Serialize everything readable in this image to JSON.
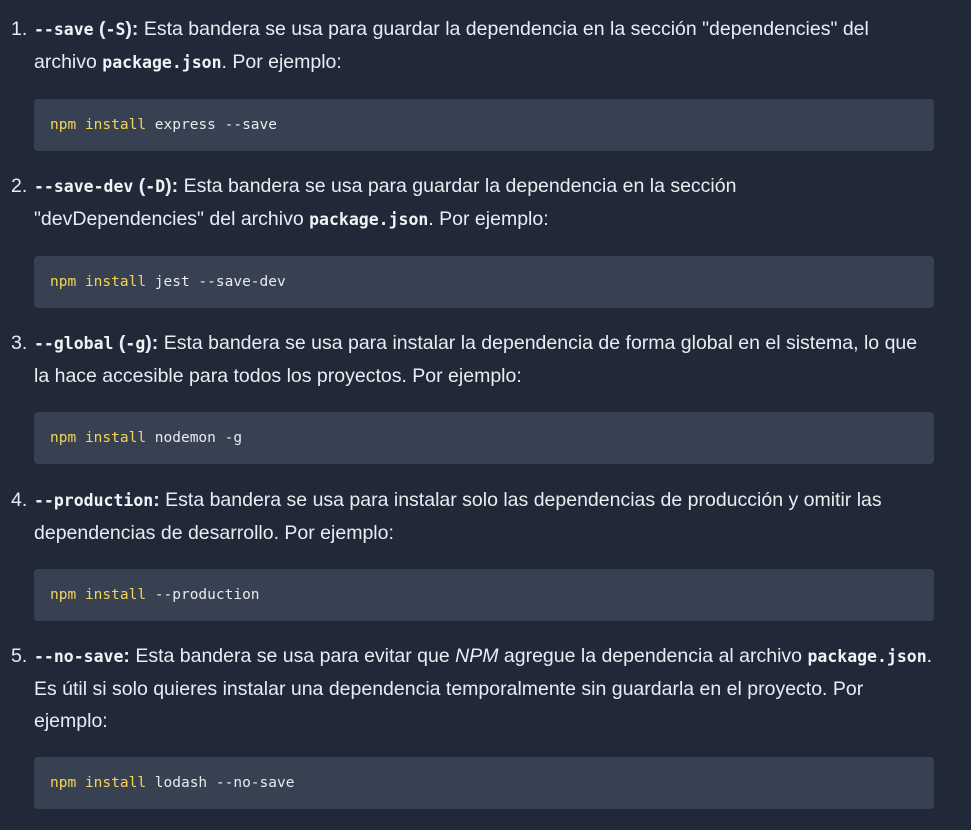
{
  "items": [
    {
      "number": "1.",
      "flag": "--save",
      "short": "-S",
      "desc": "Esta bandera se usa para guardar la dependencia en la sección \"dependencies\" del archivo",
      "file": "package.json",
      "after": ". Por ejemplo:",
      "code": {
        "cmd": "npm",
        "sub": "install",
        "args": "express --save"
      }
    },
    {
      "number": "2.",
      "flag": "--save-dev",
      "short": "-D",
      "desc": "Esta bandera se usa para guardar la dependencia en la sección \"devDependencies\" del archivo",
      "file": "package.json",
      "after": ". Por ejemplo:",
      "code": {
        "cmd": "npm",
        "sub": "install",
        "args": "jest --save-dev"
      }
    },
    {
      "number": "3.",
      "flag": "--global",
      "short": "-g",
      "desc": "Esta bandera se usa para instalar la dependencia de forma global en el sistema, lo que la hace accesible para todos los proyectos. Por ejemplo:",
      "code": {
        "cmd": "npm",
        "sub": "install",
        "args": "nodemon -g"
      }
    },
    {
      "number": "4.",
      "flag": "--production",
      "desc": "Esta bandera se usa para instalar solo las dependencias de producción y omitir las dependencias de desarrollo. Por ejemplo:",
      "code": {
        "cmd": "npm",
        "sub": "install",
        "args": "--production"
      }
    },
    {
      "number": "5.",
      "flag": "--no-save",
      "desc_before": "Esta bandera se usa para evitar que",
      "desc_em": "NPM",
      "desc_after": "agregue la dependencia al archivo",
      "file": "package.json",
      "after": ". Es útil si solo quieres instalar una dependencia temporalmente sin guardarla en el proyecto. Por ejemplo:",
      "code": {
        "cmd": "npm",
        "sub": "install",
        "args": "lodash --no-save"
      }
    }
  ]
}
